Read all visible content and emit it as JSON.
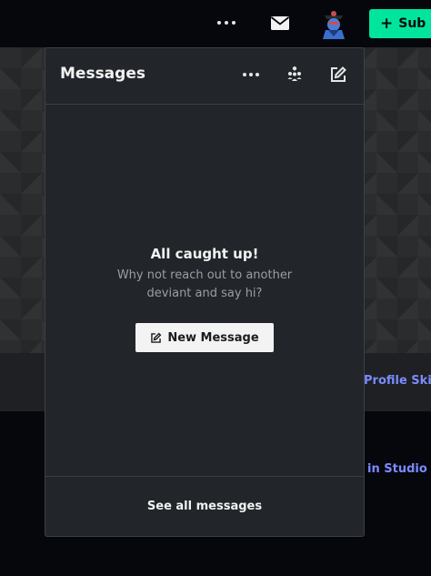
{
  "header": {
    "submit_label": "Sub",
    "icons": [
      "more-horizontal-icon",
      "mail-icon",
      "avatar",
      "plus-icon"
    ]
  },
  "page": {
    "profile_skin_label": "Profile Skin",
    "studio_label": "in Studio"
  },
  "messages_panel": {
    "title": "Messages",
    "header_icons": [
      "more-horizontal-icon",
      "group-icon",
      "compose-icon"
    ],
    "empty_title": "All caught up!",
    "empty_subtitle": "Why not reach out to another deviant and say hi?",
    "new_message_label": "New Message",
    "see_all_label": "See all messages"
  },
  "colors": {
    "accent_green": "#00e59b",
    "link_purple": "#7b8bff",
    "panel_bg": "#22262a"
  }
}
